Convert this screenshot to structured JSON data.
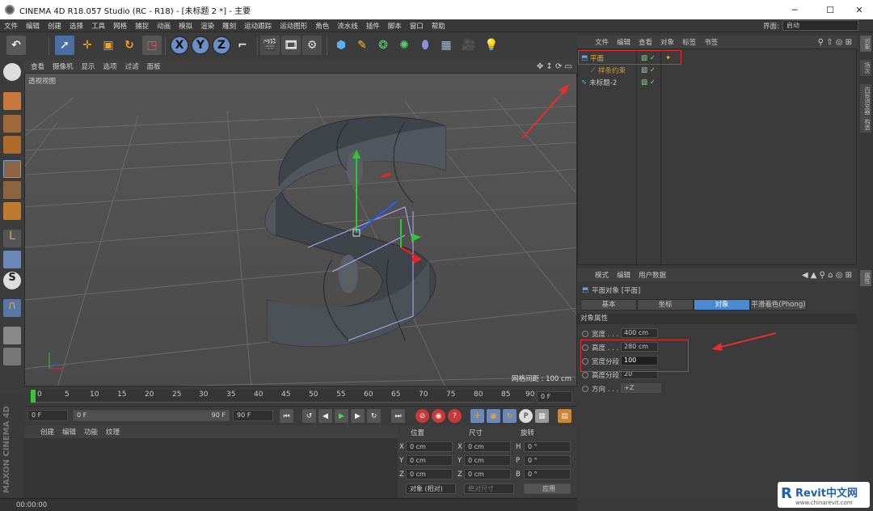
{
  "window": {
    "title": "CINEMA 4D R18.057 Studio (RC - R18) - [未标题 2 *] - 主要",
    "minimize": "─",
    "maximize": "☐",
    "close": "✕"
  },
  "menubar": {
    "items": [
      "文件",
      "编辑",
      "创建",
      "选择",
      "工具",
      "网格",
      "捕捉",
      "动画",
      "模拟",
      "渲染",
      "雕刻",
      "运动跟踪",
      "运动图形",
      "角色",
      "流水线",
      "插件",
      "脚本",
      "窗口",
      "帮助"
    ],
    "layout_label": "界面:",
    "layout_value": "启动"
  },
  "toolbar": {
    "undo": "↶",
    "x": "X",
    "y": "Y",
    "z": "Z"
  },
  "viewport": {
    "menu": [
      "查看",
      "摄像机",
      "显示",
      "选项",
      "过滤",
      "面板"
    ],
    "label": "透视视图",
    "grid_spacing": "网格间距 : 100 cm"
  },
  "timeline": {
    "ticks": [
      "0",
      "5",
      "10",
      "15",
      "20",
      "25",
      "30",
      "35",
      "40",
      "45",
      "50",
      "55",
      "60",
      "65",
      "70",
      "75",
      "80",
      "85",
      "90"
    ],
    "end_field": "0 F"
  },
  "playback": {
    "start": "0 F",
    "range_start": "0 F",
    "range_end": "90 F",
    "end": "90 F"
  },
  "material": {
    "menu": [
      "创建",
      "编辑",
      "功能",
      "纹理"
    ]
  },
  "coords": {
    "headers": [
      "位置",
      "尺寸",
      "旋转"
    ],
    "rows": [
      {
        "a": "X",
        "pos": "0 cm",
        "b": "X",
        "size": "0 cm",
        "c": "H",
        "rot": "0 °"
      },
      {
        "a": "Y",
        "pos": "0 cm",
        "b": "Y",
        "size": "0 cm",
        "c": "P",
        "rot": "0 °"
      },
      {
        "a": "Z",
        "pos": "0 cm",
        "b": "Z",
        "size": "0 cm",
        "c": "B",
        "rot": "0 °"
      }
    ],
    "mode": "对象 (相对)",
    "size_mode": "绝对尺寸",
    "apply": "应用"
  },
  "status": {
    "time": "00:00:00"
  },
  "branding": {
    "maxon": "MAXON CINEMA 4D"
  },
  "objmanager": {
    "menu": [
      "文件",
      "编辑",
      "查看",
      "对象",
      "标签",
      "书签"
    ],
    "objects": [
      {
        "name": "平面",
        "color": "#e8b34a"
      },
      {
        "name": "样条约束",
        "color": "#c89a3a"
      },
      {
        "name": "未标题-2",
        "color": "#cfcfcf"
      }
    ]
  },
  "attrmanager": {
    "menu": [
      "模式",
      "编辑",
      "用户数据"
    ],
    "object_title": "平面对象 [平面]",
    "tabs": [
      "基本",
      "坐标",
      "对象",
      "平滑着色(Phong)"
    ],
    "section": "对象属性",
    "rows": [
      {
        "label": "宽度 . . .",
        "value": "400 cm"
      },
      {
        "label": "高度 . . .",
        "value": "280 cm"
      },
      {
        "label": "宽度分段",
        "value": "100"
      },
      {
        "label": "高度分段",
        "value": "20"
      },
      {
        "label": "方向 . . .",
        "value": "+Z"
      }
    ]
  },
  "rightstrip": {
    "tabs": [
      "对象",
      "场次",
      "内容浏览器",
      "构造"
    ],
    "attr_tab": "属性"
  },
  "watermark": {
    "brand": "Revit中文网",
    "url": "www.chinarevit.com"
  },
  "colors": {
    "accent_blue": "#4a90d9",
    "annotation_red": "#e23030",
    "selected_tab": "#4a8ad4"
  }
}
